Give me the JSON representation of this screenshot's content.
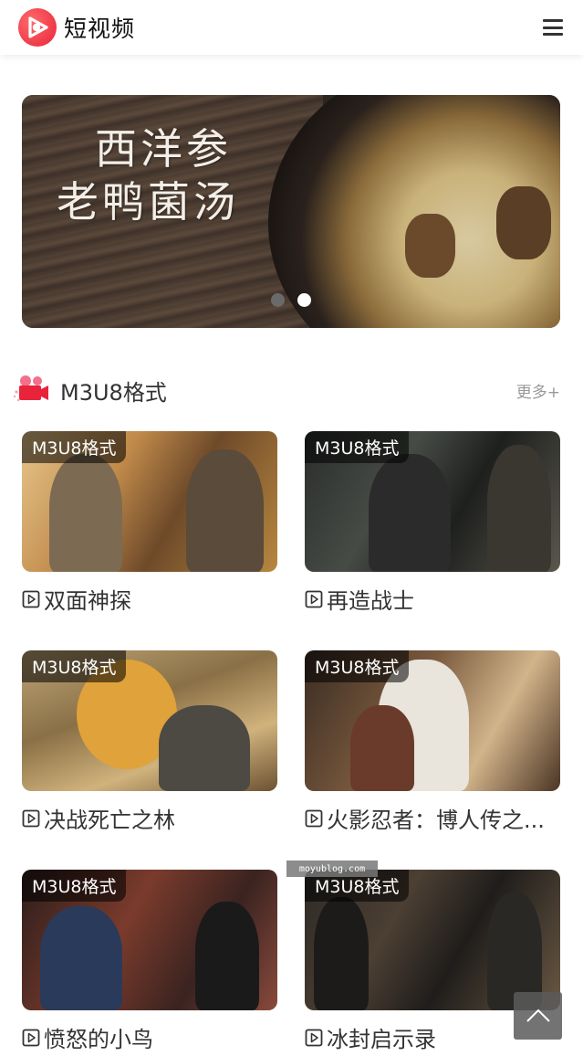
{
  "header": {
    "brand_name": "短视频",
    "logo_icon": "play-logo-icon",
    "menu_icon": "hamburger-menu-icon",
    "brand_color": "#e8233a"
  },
  "banner": {
    "title_line1": "西洋参",
    "title_line2": "老鸭菌汤",
    "slide_count": 2,
    "active_slide": 2
  },
  "section": {
    "icon": "video-camera-icon",
    "title": "M3U8格式",
    "more_label": "更多+"
  },
  "videos": [
    {
      "badge": "M3U8格式",
      "title": "双面神探"
    },
    {
      "badge": "M3U8格式",
      "title": "再造战士"
    },
    {
      "badge": "M3U8格式",
      "title": "决战死亡之林"
    },
    {
      "badge": "M3U8格式",
      "title": "火影忍者：博人传之..."
    },
    {
      "badge": "M3U8格式",
      "title": "愤怒的小鸟"
    },
    {
      "badge": "M3U8格式",
      "title": "冰封启示录"
    }
  ],
  "watermark": "moyublog.com",
  "back_to_top_icon": "chevron-up-icon"
}
